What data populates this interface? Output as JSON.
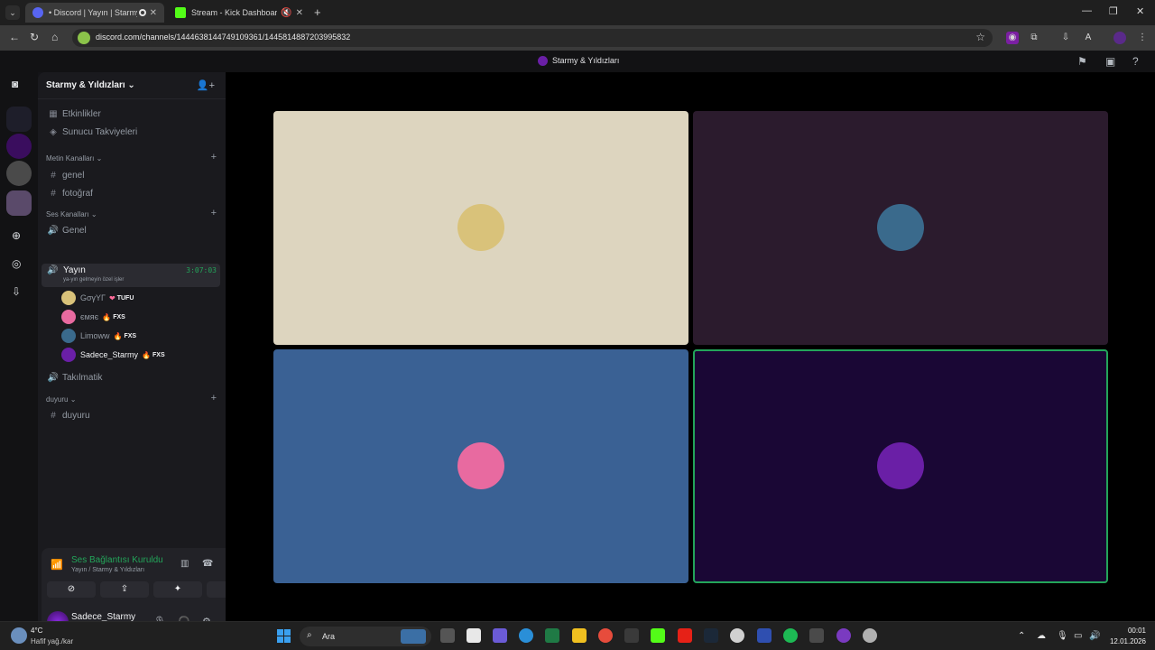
{
  "browser": {
    "tabs": [
      {
        "title": "• Discord | Yayın | Starmy &"
      },
      {
        "title": "Stream - Kick Dashboard"
      }
    ],
    "url": "discord.com/channels/1444638144749109361/1445814887203995832"
  },
  "discord": {
    "window_title": "Starmy & Yıldızları",
    "server_name": "Starmy & Yıldızları",
    "quick_links": [
      {
        "label": "Etkinlikler"
      },
      {
        "label": "Sunucu Takviyeleri"
      }
    ],
    "categories": {
      "text": {
        "label": "Metin Kanalları"
      },
      "voice": {
        "label": "Ses Kanalları"
      },
      "announce": {
        "label": "duyuru"
      }
    },
    "text_channels": [
      "genel",
      "fotoğraf"
    ],
    "voice_channels": [
      "Genel",
      "Yayın",
      "Takılmatik"
    ],
    "announce_channels": [
      "duyuru"
    ],
    "active_voice": {
      "name": "Yayın",
      "timer": "3:07:03",
      "status": "ya-yın gelmeyin özel işler"
    },
    "members": [
      {
        "name": "GσγΥΓ",
        "tag": "TUFU",
        "badge": "heart"
      },
      {
        "name": "ємяє",
        "tag": "FXS",
        "badge": "flame"
      },
      {
        "name": "Limoww",
        "tag": "FXS",
        "badge": "flame"
      },
      {
        "name": "Sadece_Starmy",
        "tag": "FXS",
        "badge": "flame"
      }
    ],
    "voice_panel": {
      "status": "Ses Bağlantısı Kuruldu",
      "sub": "Yayın / Starmy & Yıldızları"
    },
    "user": {
      "name": "Sadece_Starmy",
      "status": "● • ✨"
    },
    "tiles": [
      {
        "bg": "#ddd5bf",
        "avatar": "#d9c27a"
      },
      {
        "bg": "#2b1b2d",
        "avatar": "#3a6a8c"
      },
      {
        "bg": "#3a6194",
        "avatar": "#e86aa0"
      },
      {
        "bg": "#1a0735",
        "avatar": "#6a1fa6"
      }
    ]
  },
  "taskbar": {
    "weather_temp": "4°C",
    "weather_desc": "Hafif yağ./kar",
    "search_placeholder": "Ara",
    "time": "00:01",
    "date": "12.01.2026"
  }
}
